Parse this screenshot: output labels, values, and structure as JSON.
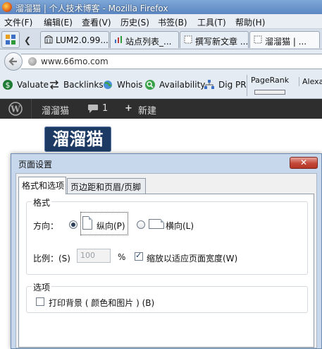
{
  "window": {
    "title": "溜溜猫 | 个人技术博客 - Mozilla Firefox"
  },
  "menu": [
    "文件(F)",
    "编辑(E)",
    "查看(V)",
    "历史(S)",
    "书签(B)",
    "工具(T)",
    "帮助(H)"
  ],
  "tabs": [
    {
      "label": "LUM2.0.99..."
    },
    {
      "label": "站点列表_..."
    },
    {
      "label": "撰写新文章 ..."
    },
    {
      "label": "溜溜猫 | ..."
    }
  ],
  "nav": {
    "url": "www.66mo.com"
  },
  "toolbar": {
    "items": [
      "Valuate",
      "Backlinks",
      "Whois",
      "Availability",
      "Dig PR"
    ],
    "pagerank": "PageRank",
    "alexa": "Alexa"
  },
  "wpbar": {
    "site": "溜溜猫",
    "comments": "1",
    "new": "新建"
  },
  "site": {
    "logo": "溜溜猫"
  },
  "dialog": {
    "title": "页面设置",
    "close": "✕",
    "tabs": [
      "格式和选项",
      "页边距和页眉/页脚"
    ],
    "format": {
      "group_title": "格式",
      "orientation_label": "方向：",
      "portrait": "纵向(P)",
      "landscape": "横向(L)",
      "portrait_selected": true,
      "scale_label": "比例：(S)",
      "scale_value": "100",
      "percent": "%",
      "shrink_to_fit": "缩放以适应页面宽度(W)",
      "shrink_checked": true
    },
    "options": {
      "group_title": "选项",
      "print_background": "打印背景 ( 颜色和图片 ) (B)",
      "print_background_checked": false
    }
  }
}
